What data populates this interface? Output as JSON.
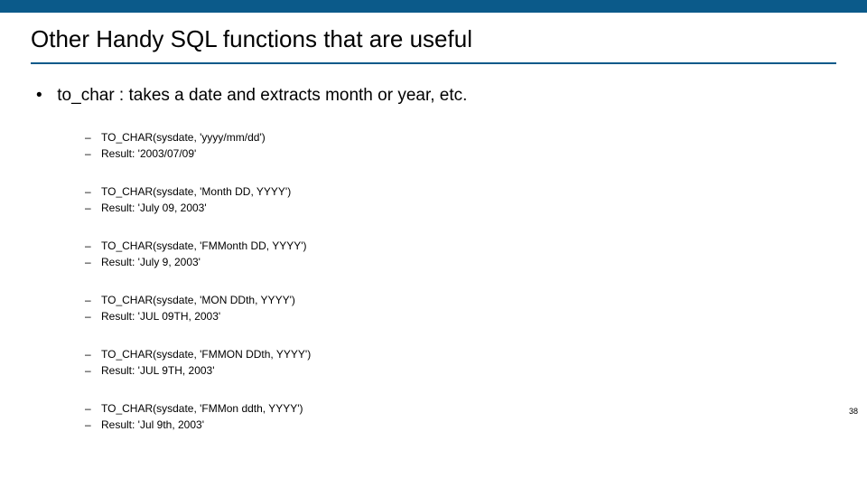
{
  "topbar_color": "#0b5a8a",
  "title": "Other Handy SQL functions that are useful",
  "main_bullet": "to_char : takes a date and extracts month or year, etc.",
  "examples": [
    {
      "func": "TO_CHAR(sysdate, 'yyyy/mm/dd')",
      "result": "Result: '2003/07/09'"
    },
    {
      "func": "TO_CHAR(sysdate, 'Month DD, YYYY')",
      "result": "Result: 'July 09, 2003'"
    },
    {
      "func": "TO_CHAR(sysdate, 'FMMonth DD, YYYY')",
      "result": "Result: 'July 9, 2003'"
    },
    {
      "func": "TO_CHAR(sysdate, 'MON DDth, YYYY')",
      "result": "Result: 'JUL 09TH, 2003'"
    },
    {
      "func": "TO_CHAR(sysdate, 'FMMON DDth, YYYY')",
      "result": "Result: 'JUL 9TH, 2003'"
    },
    {
      "func": "TO_CHAR(sysdate, 'FMMon ddth, YYYY')",
      "result": "Result: 'Jul 9th, 2003'"
    }
  ],
  "page_number": "38"
}
